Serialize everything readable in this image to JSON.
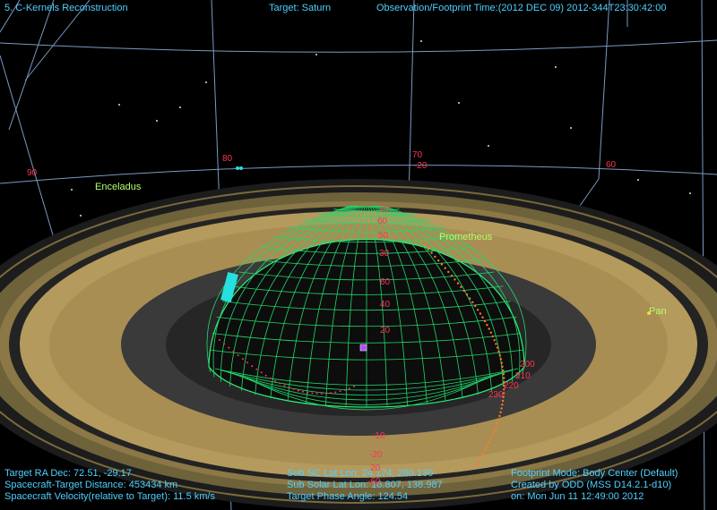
{
  "hud": {
    "top_left": "5. C-Kernels Reconstruction",
    "target": "Target: Saturn",
    "observation_time": "Observation/Footprint Time:(2012 DEC 09) 2012-344T23:30:42:00",
    "bottom_left": [
      "Target RA Dec: 72.51, -29.17",
      "Spacecraft-Target Distance: 453434 km",
      "Spacecraft Velocity(relative to Target): 11.5 km/s"
    ],
    "bottom_center": [
      "Sub SC Lat Lon: 24.174, 280.130",
      "Sub Solar Lat Lon: 16.807, 138.987",
      "Target Phase Angle: 124.54"
    ],
    "bottom_right": [
      "Footprint Mode: Body Center (Default)",
      "Created by ODD (MSS D14.2.1-d10)",
      "on: Mon Jun 11 12:49:00 2012"
    ]
  },
  "bodies": [
    "Enceladus",
    "Prometheus",
    "Pan"
  ],
  "sky_labels": [
    "90",
    "80",
    "70",
    "-20",
    "60"
  ],
  "planet_lat_labels": [
    "80",
    "60",
    "50",
    "30",
    "60",
    "40",
    "20",
    "-10",
    "-20",
    "20",
    "-60"
  ],
  "planet_lon_labels": [
    "200",
    "210",
    "220",
    "230"
  ],
  "colors": {
    "background": "#000000",
    "hud_text": "#4fd0ff",
    "planet_grid": "#21d86a",
    "grid_labels": "#ff3355",
    "body_labels": "#b7ff6a",
    "ring_gold": "#b49a5d",
    "trajectory": "#ff7a2a"
  }
}
